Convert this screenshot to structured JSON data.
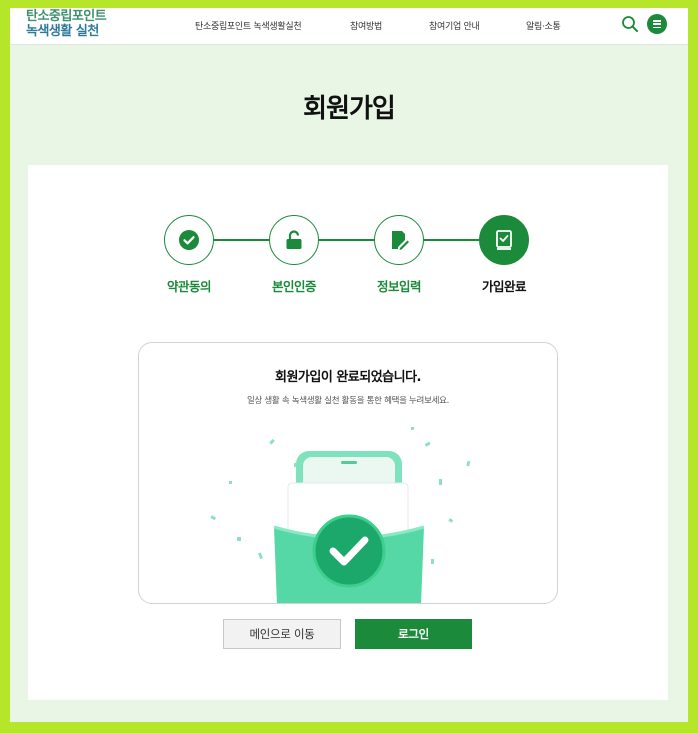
{
  "header": {
    "logo_line1": "탄소중립포인트",
    "logo_line2": "녹색생활 실천",
    "nav": [
      "탄소중립포인트 녹색생활실천",
      "참여방법",
      "참여기업 안내",
      "알림·소통"
    ]
  },
  "page_title": "회원가입",
  "steps": [
    {
      "label": "약관동의",
      "icon": "check-circle-icon",
      "active": false
    },
    {
      "label": "본인인증",
      "icon": "unlock-icon",
      "active": false
    },
    {
      "label": "정보입력",
      "icon": "edit-document-icon",
      "active": false
    },
    {
      "label": "가입완료",
      "icon": "registered-document-icon",
      "active": true
    }
  ],
  "result": {
    "title": "회원가입이 완료되었습니다.",
    "description": "일상 생활 속 녹색생활 실천 활동을 통한 혜택을 누려보세요."
  },
  "buttons": {
    "main": "메인으로 이동",
    "login": "로그인"
  },
  "colors": {
    "accent": "#1b8a3a",
    "outer_border": "#b6e62a",
    "page_bg": "#e9f6e6"
  }
}
